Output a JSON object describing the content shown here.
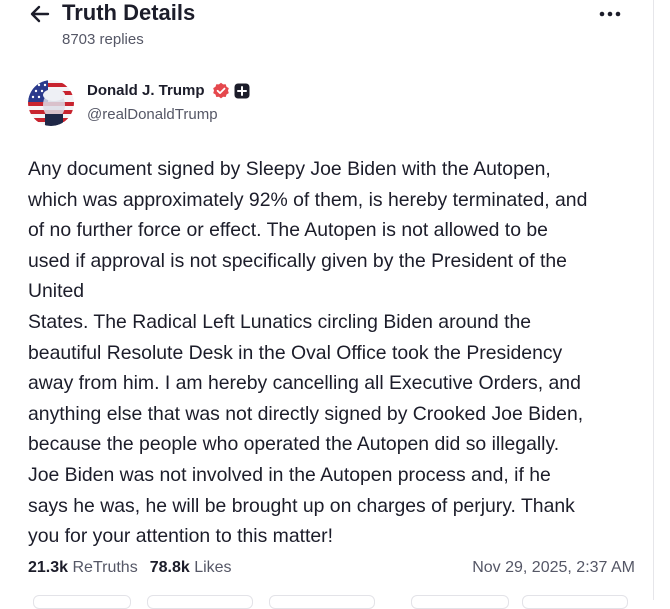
{
  "header": {
    "title": "Truth Details",
    "reply_count": "8703 replies"
  },
  "author": {
    "name": "Donald J. Trump",
    "handle": "@realDonaldTrump"
  },
  "post": {
    "lines": [
      "Any document signed by Sleepy Joe Biden with the Autopen,",
      "which was approximately 92% of them, is hereby terminated, and",
      "of no further force or effect. The Autopen is not allowed to be",
      "used if approval is not specifically given by the President of the",
      "United",
      "States. The Radical Left Lunatics circling Biden around the",
      "beautiful Resolute Desk in the Oval Office took the Presidency",
      "away from him. I am hereby cancelling all Executive Orders, and",
      "anything else that was not directly signed by Crooked Joe Biden,",
      "because the people who operated the Autopen did so illegally.",
      "Joe Biden was not involved in the Autopen process and, if he",
      "says he was, he will be brought up on charges of perjury. Thank",
      "you for your attention to this matter!"
    ]
  },
  "stats": {
    "retruths_count": "21.3k",
    "retruths_label": "ReTruths",
    "likes_count": "78.8k",
    "likes_label": "Likes"
  },
  "timestamp": "Nov 29, 2025, 2:37 AM",
  "icons": {
    "back": "arrow-left-icon",
    "more": "more-horizontal-icon",
    "verified": "verified-badge-icon",
    "plus": "plus-badge-icon"
  },
  "colors": {
    "verified": "#e5484d",
    "text_primary": "#1c1d2a",
    "text_secondary": "#555766"
  }
}
